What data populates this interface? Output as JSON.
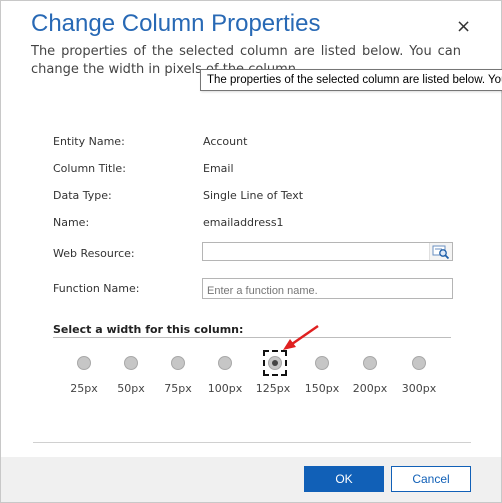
{
  "dialog": {
    "title": "Change Column Properties",
    "close_glyph": "×",
    "description": "The properties of the selected column are listed below. You can change the width in pixels of the column.",
    "tooltip": "The properties of the selected column are listed below. You can change the width in pixels of the column."
  },
  "properties": {
    "entity_label": "Entity Name:",
    "entity_value": "Account",
    "column_title_label": "Column Title:",
    "column_title_value": "Email",
    "data_type_label": "Data Type:",
    "data_type_value": "Single Line of Text",
    "name_label": "Name:",
    "name_value": "emailaddress1",
    "web_resource_label": "Web Resource:",
    "web_resource_value": "",
    "function_name_label": "Function Name:",
    "function_name_placeholder": "Enter a function name.",
    "function_name_value": ""
  },
  "width_section": {
    "label": "Select a width for this column:",
    "options": [
      "25px",
      "50px",
      "75px",
      "100px",
      "125px",
      "150px",
      "200px",
      "300px"
    ],
    "selected": "125px"
  },
  "buttons": {
    "ok": "OK",
    "cancel": "Cancel"
  },
  "colors": {
    "title": "#2869b5",
    "primary_button": "#1160b7",
    "annotation_arrow": "#e02020"
  },
  "icons": {
    "close": "close-icon",
    "lookup": "lookup-search-icon",
    "annotation": "red-arrow-icon"
  }
}
